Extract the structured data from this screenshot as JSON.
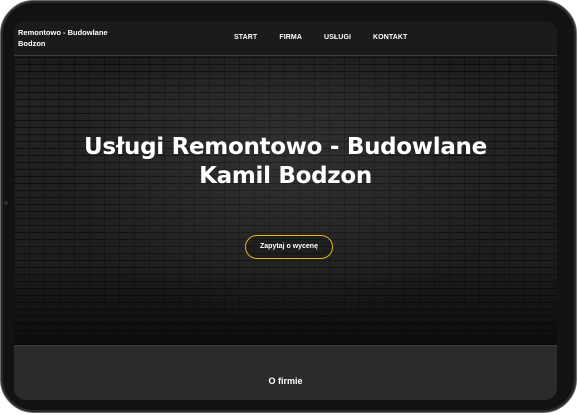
{
  "brand": {
    "line1": "Remontowo - Budowlane",
    "line2": "Bodzon"
  },
  "nav": {
    "items": [
      {
        "label": "START"
      },
      {
        "label": "FIRMA"
      },
      {
        "label": "USŁUGI"
      },
      {
        "label": "KONTAKT"
      }
    ]
  },
  "hero": {
    "title_line1": "Usługi Remontowo - Budowlane",
    "title_line2": "Kamil Bodzon",
    "cta_label": "Zapytaj o wycenę"
  },
  "section": {
    "title": "O firmie"
  },
  "colors": {
    "accent": "#e6b21f",
    "background": "#1d1d1d",
    "navbar": "#1b1b1b",
    "section": "#2b2b2b"
  }
}
